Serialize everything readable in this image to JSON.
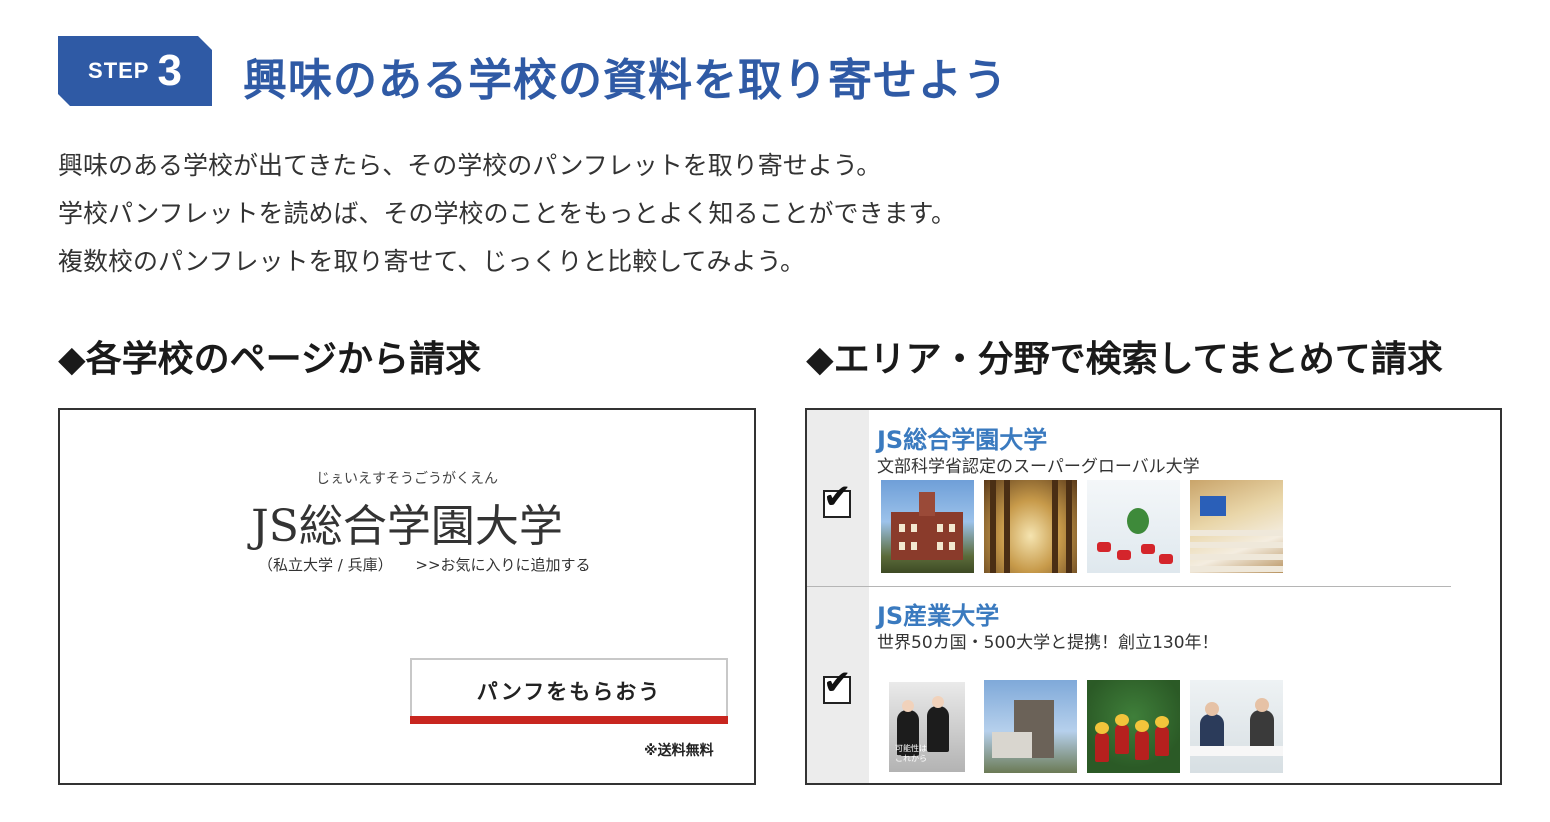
{
  "step": {
    "word": "STEP",
    "number": "3",
    "title": "興味のある学校の資料を取り寄せよう"
  },
  "intro": [
    "興味のある学校が出てきたら、その学校のパンフレットを取り寄せよう。",
    "学校パンフレットを読めば、その学校のことをもっとよく知ることができます。",
    "複数校のパンフレットを取り寄せて、じっくりと比較してみよう。"
  ],
  "sections": {
    "left_heading": "◆各学校のページから請求",
    "right_heading": "◆エリア・分野で検索してまとめて請求"
  },
  "left_panel": {
    "ruby": "じぇいえすそうごうがくえん",
    "name": "JS総合学園大学",
    "type": "（私立大学 / 兵庫）",
    "favorite": ">>お気に入りに追加する",
    "button": "パンフをもらおう",
    "note": "※送料無料"
  },
  "right_panel": {
    "schools": [
      {
        "name": "JS総合学園大学",
        "desc": "文部科学省認定のスーパーグローバル大学",
        "checked": true,
        "thumbs": [
          "campus-building-photo",
          "library-photo",
          "lounge-photo",
          "lecture-hall-photo"
        ]
      },
      {
        "name": "JS産業大学",
        "desc": "世界50カ国・500大学と提携！創立130年！",
        "checked": true,
        "thumbs": [
          "pamphlet-cover-photo",
          "building-photo",
          "cheerleaders-photo",
          "consultation-photo"
        ],
        "pamphlet_text": "可能性は\nこれから"
      }
    ],
    "check_mark": "✔"
  },
  "colors": {
    "accent_blue": "#2f5aa5",
    "link_blue": "#3a7abf",
    "button_red": "#c8261f"
  }
}
